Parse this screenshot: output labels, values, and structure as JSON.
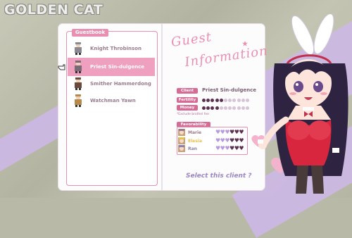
{
  "logo": "GOLDEN CAT",
  "guestbook": {
    "tab_label": "Guestbook",
    "selected_index": 1,
    "items": [
      {
        "name": "Knight Throbinson"
      },
      {
        "name": "Priest Sin-dulgence"
      },
      {
        "name": "Smither Hammerdong"
      },
      {
        "name": "Watchman Yawn"
      }
    ]
  },
  "guest_info": {
    "title_line1": "Guest",
    "title_line2": "Information",
    "client_label": "Client",
    "client_name": "Priest Sin-dulgence",
    "fertility_label": "Fertility",
    "fertility": {
      "filled": 5,
      "total": 11
    },
    "money_label": "Money",
    "money": {
      "filled": 4,
      "total": 11
    },
    "note": "*Exclude brothel fee",
    "favorability_label": "Favorability",
    "favorability": [
      {
        "name": "Marie",
        "hearts_on": 3,
        "hearts_total": 6
      },
      {
        "name": "Elesia",
        "hearts_on": 3,
        "hearts_total": 6
      },
      {
        "name": "Ran",
        "hearts_on": 3,
        "hearts_total": 6
      }
    ],
    "select_button": "Select this client ?"
  },
  "colors": {
    "pink": "#e98fb1",
    "heart_on": "#b79ae0",
    "heart_off": "#5c2f4f",
    "marie": "#9b7a8e",
    "elesia": "#e6c24a",
    "ran": "#8e7fae"
  }
}
